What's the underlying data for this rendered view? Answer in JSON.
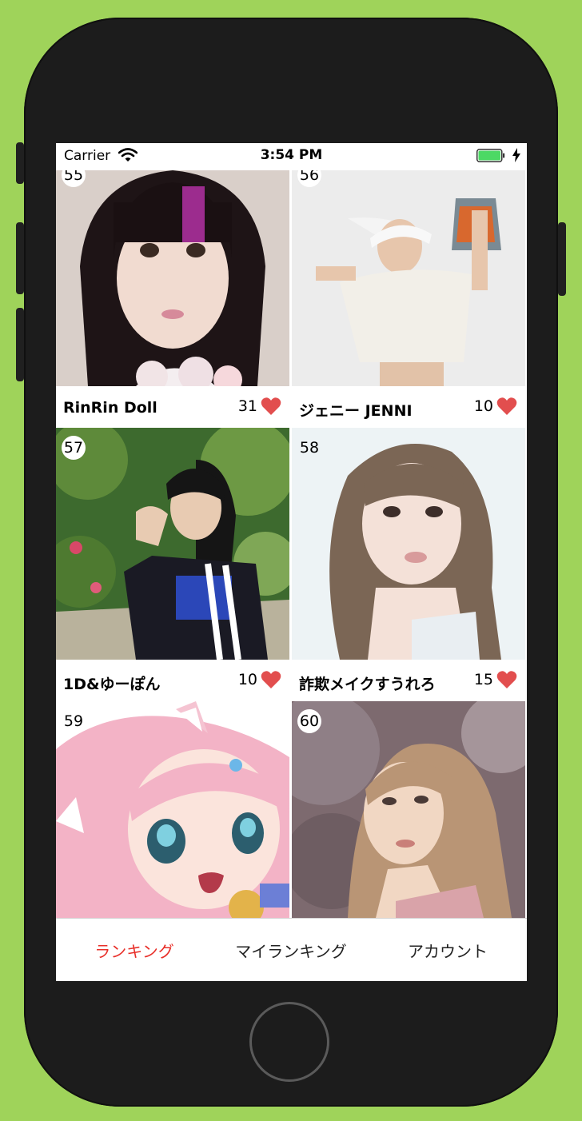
{
  "status_bar": {
    "carrier": "Carrier",
    "time": "3:54 PM",
    "wifi_icon": "wifi-icon",
    "battery_icon": "battery-charging-icon"
  },
  "cards": [
    {
      "number": "55",
      "name": "RinRin Doll",
      "likes": "31"
    },
    {
      "number": "56",
      "name": "ジェニー JENNI",
      "likes": "10"
    },
    {
      "number": "57",
      "name": "1D&ゆーぽん",
      "likes": "10"
    },
    {
      "number": "58",
      "name": "詐欺メイクすうれろ",
      "likes": "15"
    },
    {
      "number": "59"
    },
    {
      "number": "60"
    }
  ],
  "tabs": [
    {
      "label": "ランキング",
      "active": true
    },
    {
      "label": "マイランキング",
      "active": false
    },
    {
      "label": "アカウント",
      "active": false
    }
  ],
  "colors": {
    "background": "#9fd35a",
    "device": "#1c1c1c",
    "active_tab": "#e8302a",
    "heart": "#e24e4e",
    "battery": "#4cd964"
  }
}
